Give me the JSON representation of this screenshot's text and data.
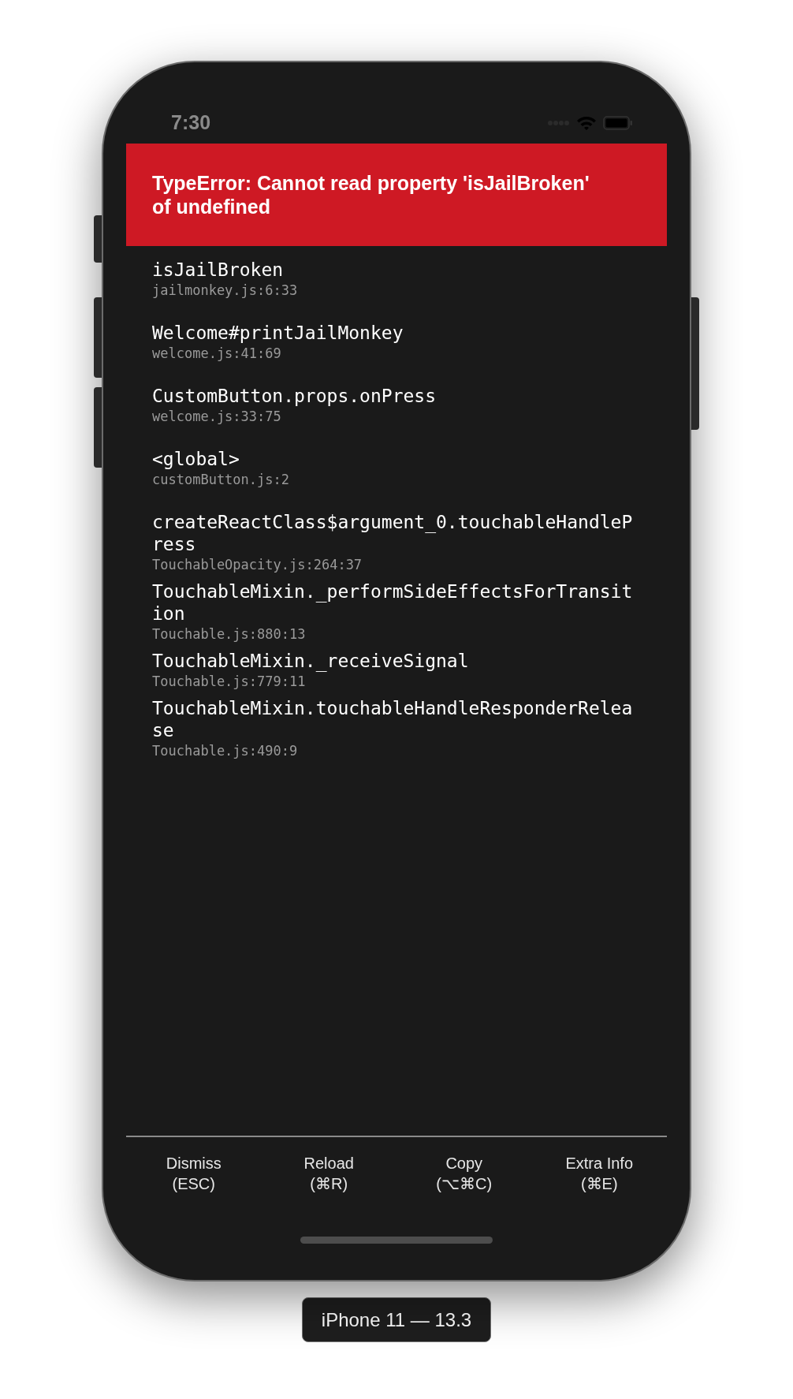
{
  "status_bar": {
    "time": "7:30"
  },
  "error": {
    "message": "TypeError: Cannot read property 'isJailBroken' of undefined"
  },
  "stack_frames": [
    {
      "method": "isJailBroken",
      "location": "jailmonkey.js:6:33"
    },
    {
      "method": "Welcome#printJailMonkey",
      "location": "welcome.js:41:69"
    },
    {
      "method": "CustomButton.props.onPress",
      "location": "welcome.js:33:75"
    },
    {
      "method": "<global>",
      "location": "customButton.js:2"
    },
    {
      "method": "createReactClass$argument_0.touchableHandlePress",
      "location": "TouchableOpacity.js:264:37"
    },
    {
      "method": "TouchableMixin._performSideEffectsForTransition",
      "location": "Touchable.js:880:13"
    },
    {
      "method": "TouchableMixin._receiveSignal",
      "location": "Touchable.js:779:11"
    },
    {
      "method": "TouchableMixin.touchableHandleResponderRelease",
      "location": "Touchable.js:490:9"
    }
  ],
  "buttons": [
    {
      "label": "Dismiss",
      "shortcut": "(ESC)"
    },
    {
      "label": "Reload",
      "shortcut": "(⌘R)"
    },
    {
      "label": "Copy",
      "shortcut": "(⌥⌘C)"
    },
    {
      "label": "Extra Info",
      "shortcut": "(⌘E)"
    }
  ],
  "device_label": "iPhone 11 — 13.3"
}
